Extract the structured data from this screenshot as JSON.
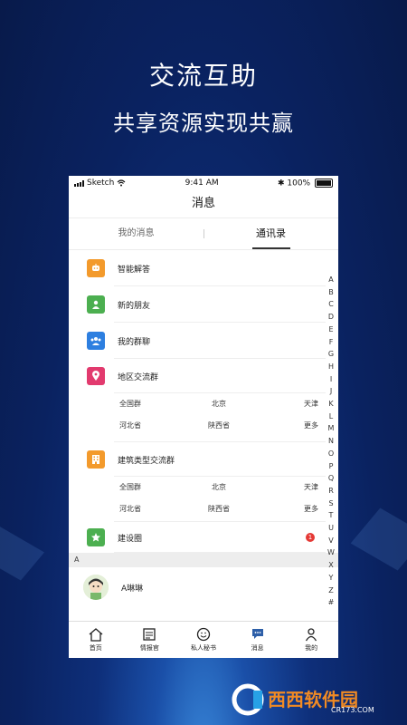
{
  "hero": {
    "title": "交流互助",
    "subtitle": "共享资源实现共赢"
  },
  "status": {
    "carrier": "Sketch",
    "time": "9:41 AM",
    "battery": "100%"
  },
  "nav": {
    "title": "消息"
  },
  "tabs": [
    {
      "label": "我的消息"
    },
    {
      "label": "通讯录"
    }
  ],
  "contacts": {
    "ai_answer": "智能解答",
    "new_friends": "新的朋友",
    "my_groups": "我的群聊",
    "regional": {
      "title": "地区交流群",
      "rows": [
        [
          "全国群",
          "北京",
          "天津"
        ],
        [
          "河北省",
          "陕西省",
          "更多"
        ]
      ]
    },
    "building": {
      "title": "建筑类型交流群",
      "rows": [
        [
          "全国群",
          "北京",
          "天津"
        ],
        [
          "河北省",
          "陕西省",
          "更多"
        ]
      ]
    },
    "jianshequan": {
      "label": "建设圈",
      "badge": "1"
    },
    "section_letter": "A",
    "person": {
      "name": "A琳琳"
    }
  },
  "alphabet": [
    "A",
    "B",
    "C",
    "D",
    "E",
    "F",
    "G",
    "H",
    "I",
    "J",
    "K",
    "L",
    "M",
    "N",
    "O",
    "P",
    "Q",
    "R",
    "S",
    "T",
    "U",
    "V",
    "W",
    "X",
    "Y",
    "Z",
    "#"
  ],
  "bottom_nav": [
    {
      "label": "首页",
      "icon": "home-icon"
    },
    {
      "label": "情报官",
      "icon": "newspaper-icon"
    },
    {
      "label": "私人秘书",
      "icon": "smiley-icon"
    },
    {
      "label": "消息",
      "icon": "chat-icon"
    },
    {
      "label": "我的",
      "icon": "person-icon"
    }
  ],
  "watermark": {
    "text1": "西西软件园",
    "text2": "CR173.COM"
  },
  "colors": {
    "orange": "#f39a2c",
    "green": "#4caf50",
    "blue": "#2d7fe0",
    "pink": "#e23a6e",
    "badge": "#e53935"
  }
}
